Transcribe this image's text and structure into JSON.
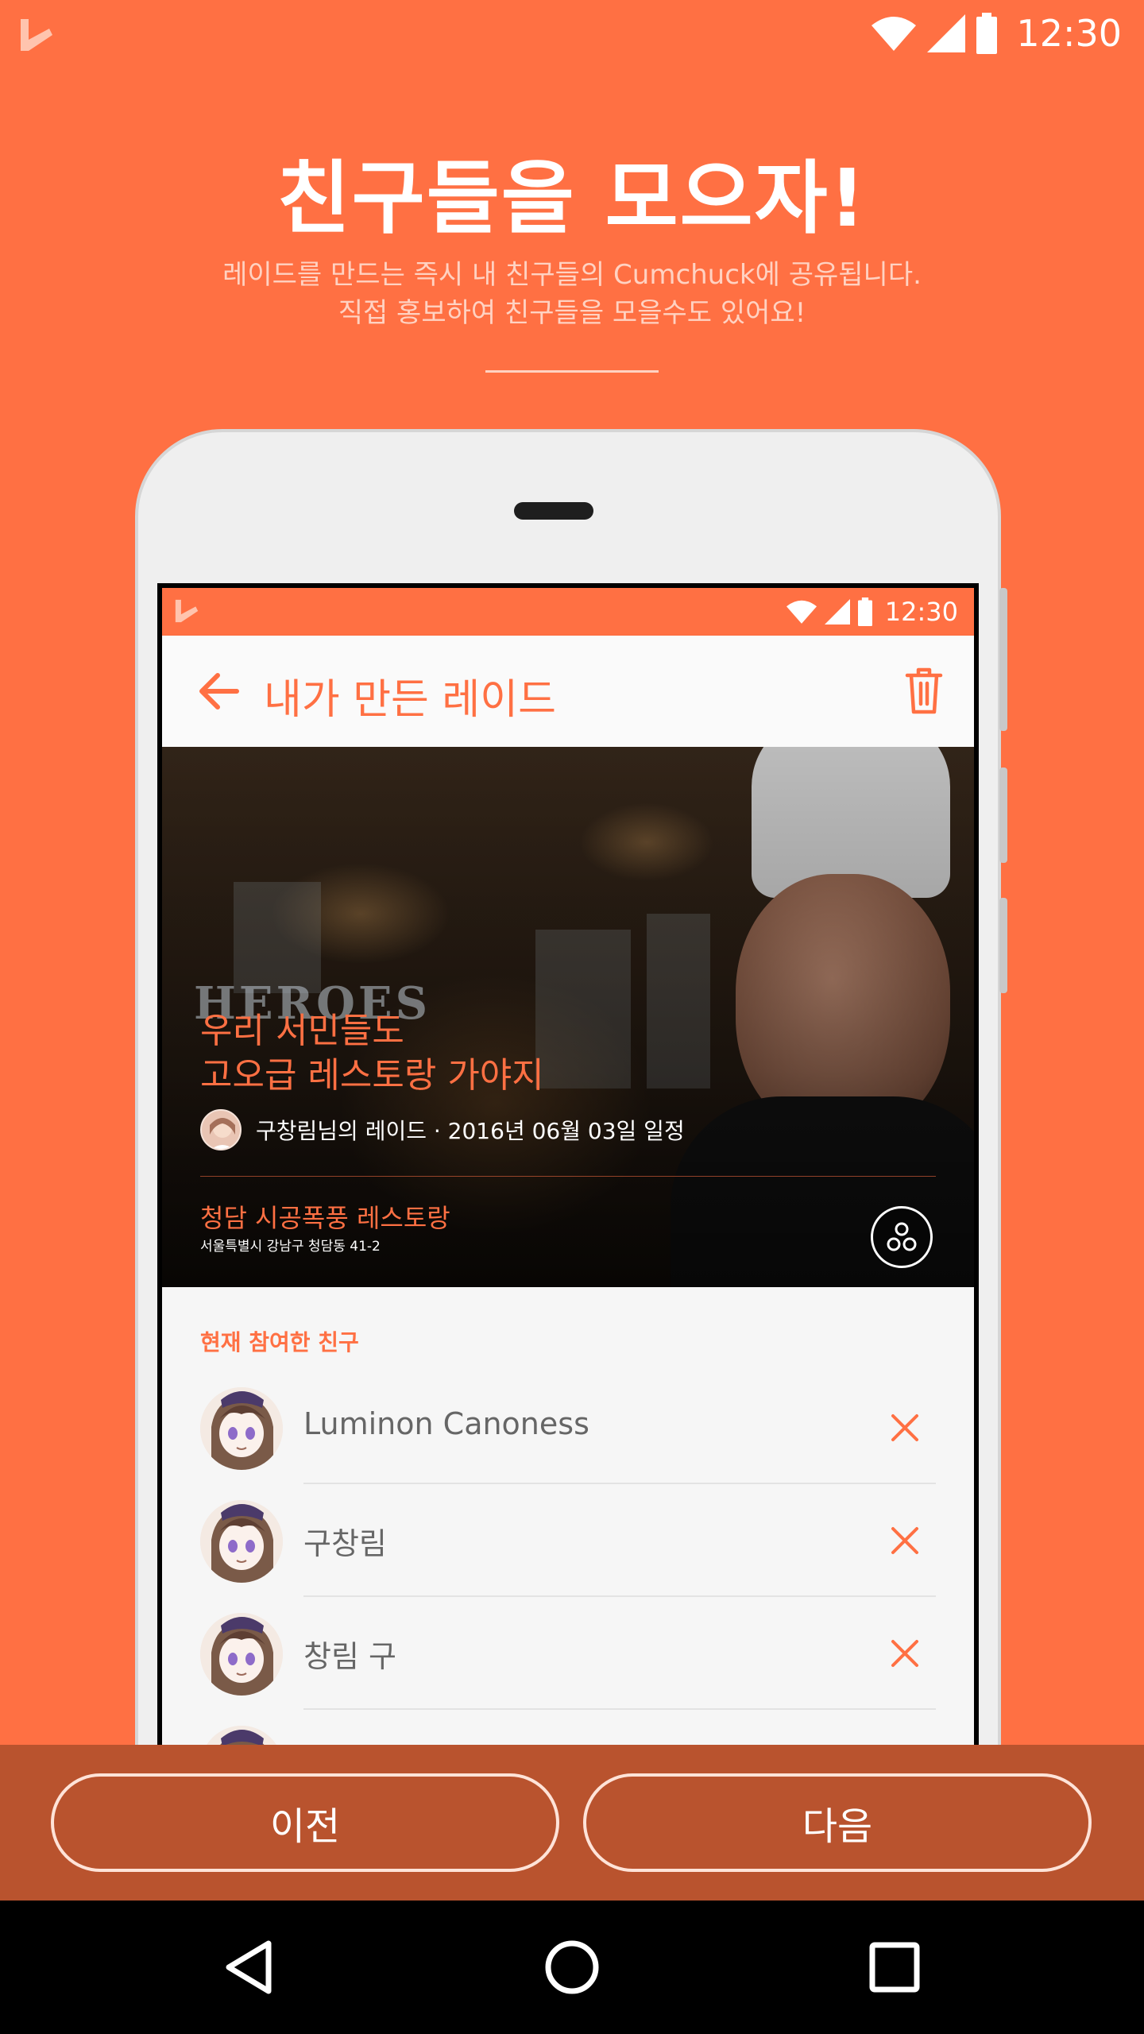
{
  "status_bar": {
    "time": "12:30"
  },
  "onboarding": {
    "headline": "친구들을 모으자!",
    "subtitle_line1": "레이드를 만드는 즉시 내 친구들의 Cumchuck에 공유됩니다.",
    "subtitle_line2": "직접 홍보하여 친구들을 모을수도 있어요!"
  },
  "device_preview": {
    "status_time": "12:30",
    "app_bar_title": "내가 만든 레이드",
    "hero": {
      "title_line1": "우리 서민들도",
      "title_line2": "고오급 레스토랑 가야지",
      "host_info": "구창림님의 레이드 · 2016년 06월 03일 일정",
      "place_name": "청담 시공폭풍 레스토랑",
      "place_address": "서울특별시 강남구 청담동 41-2",
      "background_brand": "HEROES"
    },
    "participants_heading": "현재 참여한 친구",
    "participants": [
      {
        "name": "Luminon Canoness"
      },
      {
        "name": "구창림"
      },
      {
        "name": "창림 구"
      }
    ]
  },
  "actions": {
    "prev_label": "이전",
    "next_label": "다음"
  },
  "colors": {
    "accent": "#FF7043",
    "action_bar": "#B9532E",
    "nav_bar": "#000000"
  },
  "icons": [
    "logo-icon",
    "wifi-icon",
    "signal-icon",
    "battery-icon",
    "back-arrow-icon",
    "trash-icon",
    "share-icon",
    "remove-icon",
    "nav-back-icon",
    "nav-home-icon",
    "nav-recents-icon"
  ]
}
